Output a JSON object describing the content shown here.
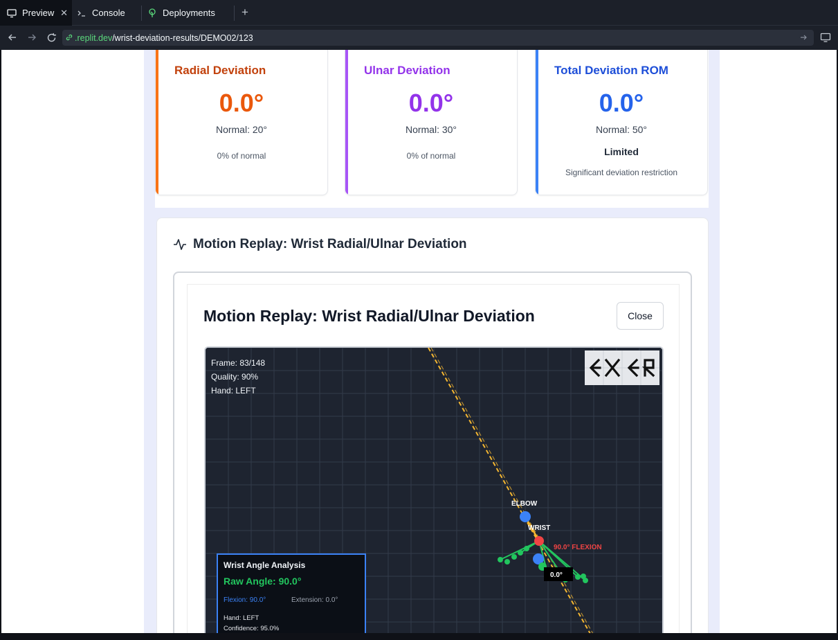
{
  "ide": {
    "tabs": [
      {
        "label": "Preview",
        "icon": "monitor-icon"
      },
      {
        "label": "Console",
        "icon": "terminal-icon"
      },
      {
        "label": "Deployments",
        "icon": "tree-icon"
      }
    ],
    "url_host": ".replit.dev",
    "url_path": "/wrist-deviation-results/DEMO02/123"
  },
  "stats": {
    "radial": {
      "title": "Radial Deviation",
      "value": "0.0°",
      "normal": "Normal: 20°",
      "percent": "0% of normal",
      "color": "#ea580c",
      "bar_color": "#f97316"
    },
    "ulnar": {
      "title": "Ulnar Deviation",
      "value": "0.0°",
      "normal": "Normal: 30°",
      "percent": "0% of normal",
      "color": "#9333ea",
      "bar_color": "#a855f7"
    },
    "total": {
      "title": "Total Deviation ROM",
      "value": "0.0°",
      "normal": "Normal: 50°",
      "status": "Limited",
      "note": "Significant deviation restriction",
      "color": "#2563eb",
      "bar_color": "#3b82f6"
    }
  },
  "replay": {
    "section_title": "Motion Replay: Wrist Radial/Ulnar Deviation",
    "modal_title": "Motion Replay: Wrist Radial/Ulnar Deviation",
    "close_label": "Close",
    "info": {
      "frame": "Frame: 83/148",
      "quality": "Quality: 90%",
      "hand": "Hand: LEFT"
    },
    "labels": {
      "elbow": "ELBOW",
      "wrist": "WRIST",
      "flexion": "90.0° FLEXION",
      "angle_box": "0.0°"
    },
    "logo_text": "EXER",
    "analysis": {
      "title": "Wrist Angle Analysis",
      "raw": "Raw Angle: 90.0°",
      "flexion": "Flexion: 90.0°",
      "extension": "Extension: 0.0°",
      "hand": "Hand: LEFT",
      "confidence": "Confidence: 95.0%"
    }
  }
}
